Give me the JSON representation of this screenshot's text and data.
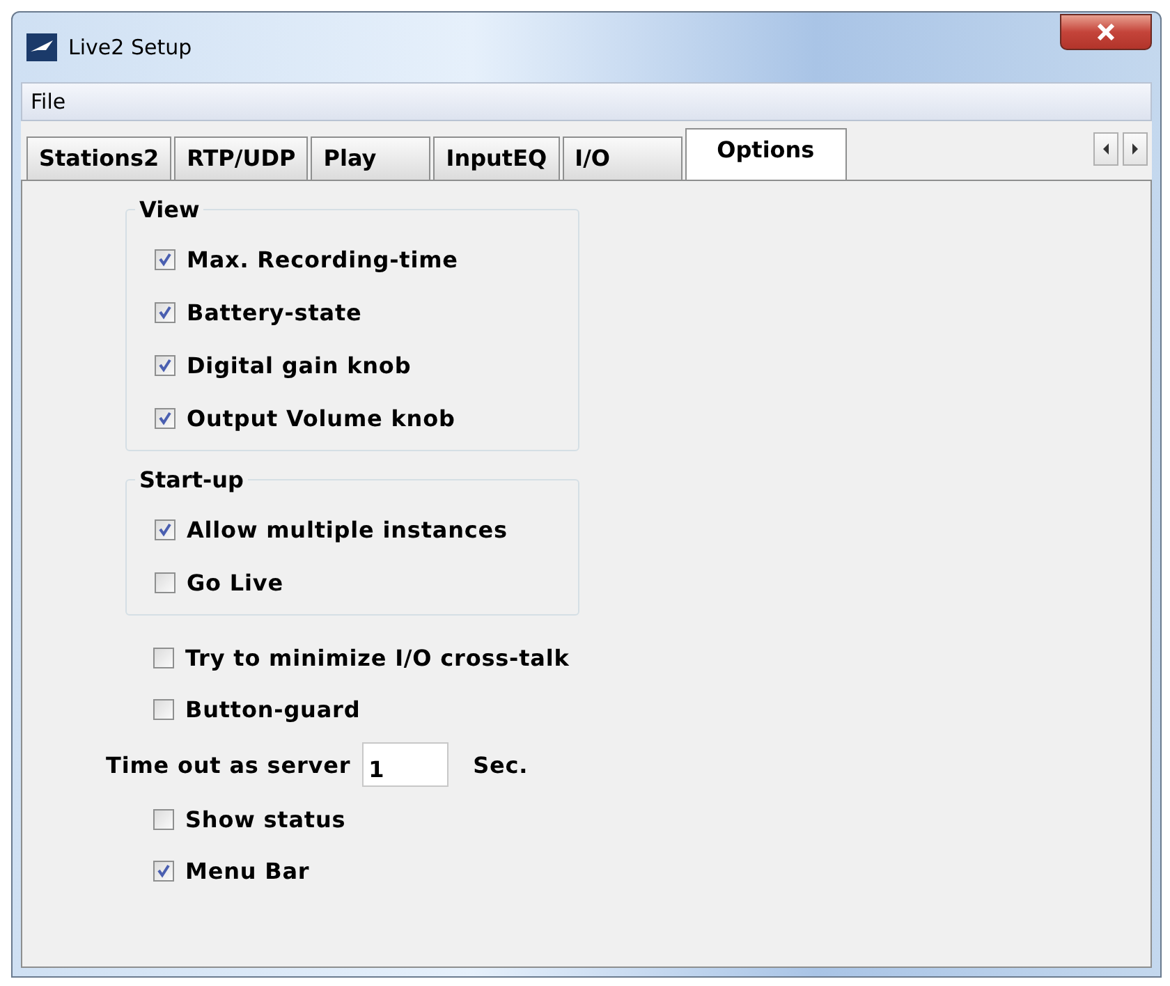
{
  "window": {
    "title": "Live2 Setup"
  },
  "menu": [
    "File"
  ],
  "tabs": [
    {
      "label": "Stations2",
      "selected": false
    },
    {
      "label": "RTP/UDP",
      "selected": false
    },
    {
      "label": "Play",
      "selected": false
    },
    {
      "label": "InputEQ",
      "selected": false
    },
    {
      "label": "I/O",
      "selected": false
    },
    {
      "label": "Options",
      "selected": true
    }
  ],
  "groups": [
    {
      "title": "View",
      "options": [
        {
          "label": "Max. Recording-time",
          "checked": true
        },
        {
          "label": "Battery-state",
          "checked": true
        },
        {
          "label": "Digital gain knob",
          "checked": true
        },
        {
          "label": "Output Volume knob",
          "checked": true
        }
      ]
    },
    {
      "title": "Start-up",
      "options": [
        {
          "label": "Allow multiple instances",
          "checked": true
        },
        {
          "label": "Go Live",
          "checked": false
        }
      ]
    }
  ],
  "settings": [
    {
      "kind": "checkbox",
      "label": "Try to minimize I/O cross-talk",
      "checked": false
    },
    {
      "kind": "checkbox",
      "label": "Button-guard",
      "checked": false
    },
    {
      "kind": "timeout",
      "label": "Time out as server",
      "value": "1",
      "unit": "Sec."
    },
    {
      "kind": "checkbox",
      "label": "Show status",
      "checked": false
    },
    {
      "kind": "checkbox",
      "label": "Menu Bar",
      "checked": true
    }
  ]
}
